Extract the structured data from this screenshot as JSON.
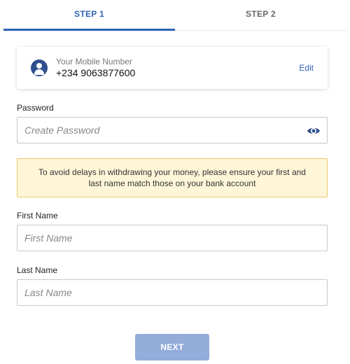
{
  "tabs": [
    {
      "label": "STEP 1",
      "active": true
    },
    {
      "label": "STEP 2",
      "active": false
    }
  ],
  "phone": {
    "label": "Your Mobile Number",
    "value": "+234 9063877600",
    "edit_label": "Edit",
    "icon": "user-icon"
  },
  "password": {
    "label": "Password",
    "placeholder": "Create Password",
    "value": "",
    "toggle_icon": "eye-icon"
  },
  "notice": {
    "text": "To avoid delays in withdrawing your money, please ensure your first and last name match those on your bank account"
  },
  "first_name": {
    "label": "First Name",
    "placeholder": "First Name",
    "value": ""
  },
  "last_name": {
    "label": "Last Name",
    "placeholder": "Last Name",
    "value": ""
  },
  "next_button": {
    "label": "NEXT"
  },
  "colors": {
    "accent": "#2f63b4",
    "notice_bg": "#fff6d8",
    "notice_border": "#e8c86a",
    "button_disabled": "#93acda"
  }
}
